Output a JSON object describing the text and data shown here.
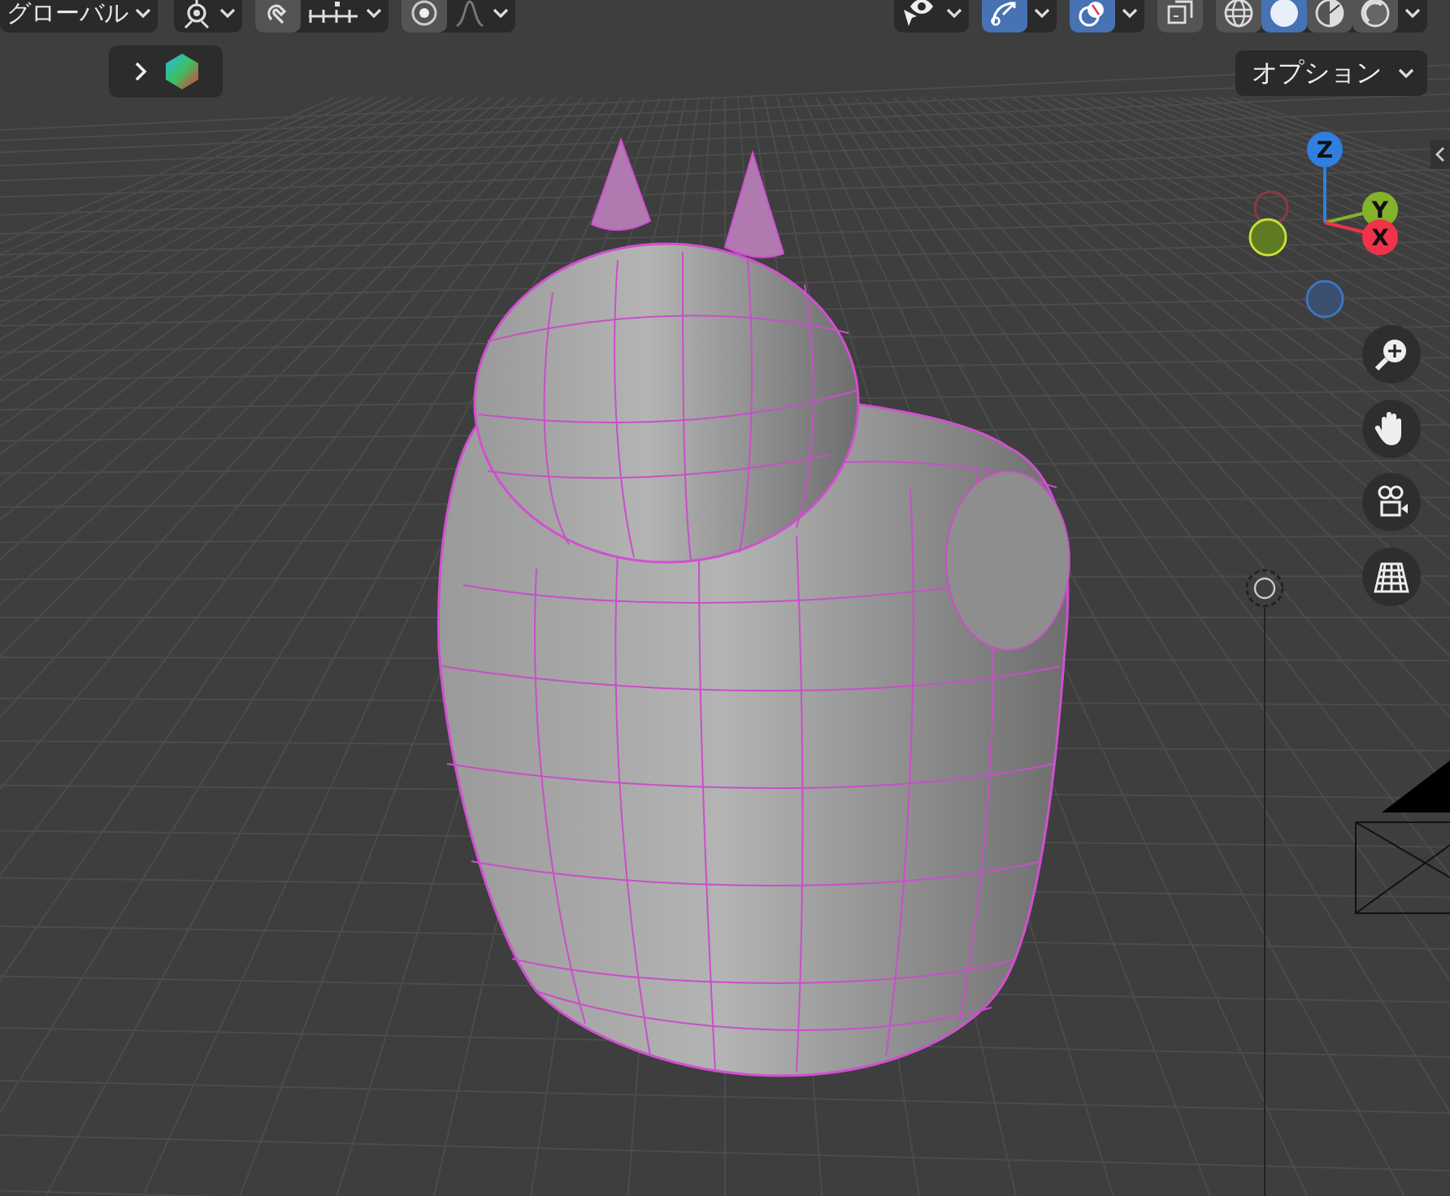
{
  "header": {
    "orientation": "グローバル",
    "toggles": [
      {
        "kind": "snap",
        "on": false
      },
      {
        "kind": "proportional",
        "on": false
      },
      {
        "kind": "gizmo",
        "on": true
      },
      {
        "kind": "overlay",
        "on": true
      },
      {
        "kind": "xray",
        "on": false
      }
    ],
    "shading_modes": [
      {
        "kind": "wireframe",
        "selected": false
      },
      {
        "kind": "solid",
        "selected": true
      },
      {
        "kind": "material",
        "selected": false
      },
      {
        "kind": "rendered",
        "selected": false
      }
    ]
  },
  "tool_settings": {
    "expanded": false
  },
  "options_menu": {
    "label": "オプション"
  },
  "axes": [
    {
      "label": "Z",
      "color": "#2f7fe0"
    },
    {
      "label": "Y",
      "color": "#84b32b"
    },
    {
      "label": "X",
      "color": "#f0324a"
    }
  ]
}
